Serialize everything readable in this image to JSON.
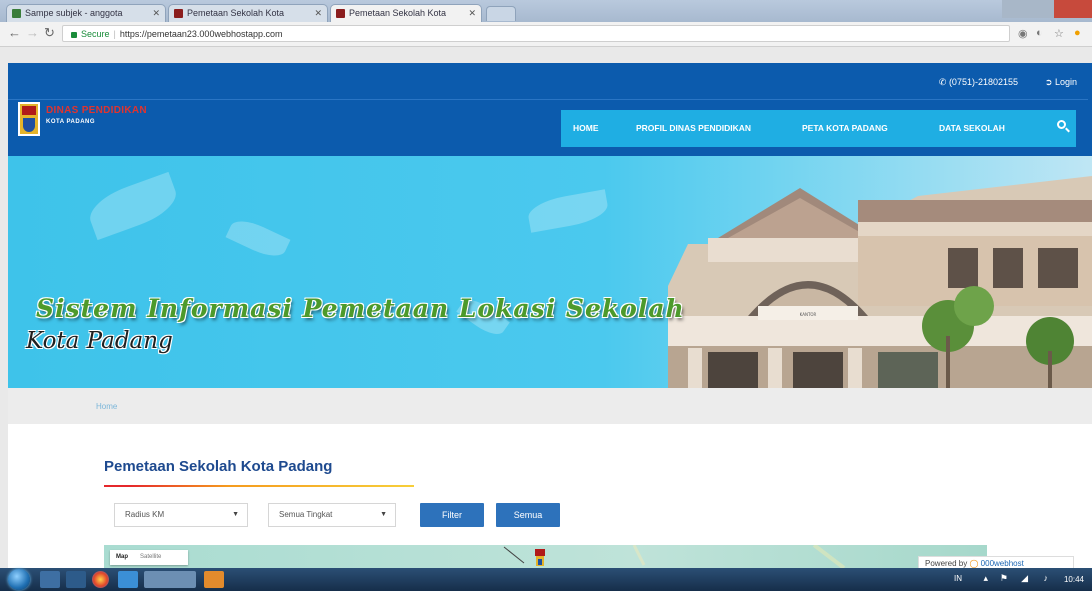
{
  "browser": {
    "tabs": [
      {
        "label": "Sampe subjek - anggota"
      },
      {
        "label": "Pemetaan Sekolah Kota"
      },
      {
        "label": "Pemetaan Sekolah Kota"
      }
    ],
    "secure_label": "Secure",
    "url": "https://pemetaan23.000webhostapp.com"
  },
  "header": {
    "phone": "(0751)-21802155",
    "login_label": "Login",
    "logo_title": "DINAS PENDIDIKAN",
    "logo_subtitle": "KOTA PADANG",
    "menu": [
      {
        "label": "HOME"
      },
      {
        "label": "PROFIL DINAS PENDIDIKAN"
      },
      {
        "label": "PETA KOTA PADANG"
      },
      {
        "label": "DATA SEKOLAH"
      }
    ]
  },
  "banner": {
    "title": "Sistem Informasi Pemetaan Lokasi Sekolah",
    "subtitle": "Kota Padang"
  },
  "breadcrumb": {
    "current": "Home"
  },
  "main": {
    "section_title": "Pemetaan Sekolah Kota Padang",
    "filters": {
      "radius": {
        "selected": "Radius KM"
      },
      "level": {
        "selected": "Semua Tingkat"
      }
    },
    "filter_button": "Filter",
    "all_button": "Semua",
    "map": {
      "map_tab": "Map",
      "satellite_tab": "Satellite"
    }
  },
  "powered_by": {
    "prefix": "Powered by",
    "brand": "000webhost"
  },
  "taskbar": {
    "time": "10:44"
  },
  "colors": {
    "header_blue": "#0c5bad",
    "menu_cyan": "#1faee3",
    "button_blue": "#2d72bb",
    "title_navy": "#1e4a8f"
  }
}
